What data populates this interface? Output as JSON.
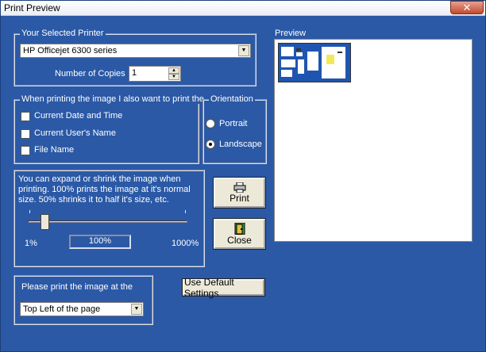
{
  "window": {
    "title": "Print Preview",
    "close_glyph": "✕"
  },
  "printer": {
    "group_label": "Your Selected Printer",
    "selected": "HP Officejet 6300 series",
    "copies_label": "Number of Copies",
    "copies_value": "1"
  },
  "options": {
    "group_label": "When printing the image I also want to print the",
    "items": [
      {
        "label": "Current Date and Time",
        "checked": false
      },
      {
        "label": "Current User's Name",
        "checked": false
      },
      {
        "label": "File Name",
        "checked": false
      }
    ]
  },
  "orientation": {
    "group_label": "Orientation",
    "portrait": "Portrait",
    "landscape": "Landscape",
    "selected": "Landscape"
  },
  "scale": {
    "description": "You can expand or shrink the image when printing.  100% prints the image at it's normal size.  50% shrinks it to half it's size, etc.",
    "min_label": "1%",
    "max_label": "1000%",
    "value_label": "100%",
    "value": 100
  },
  "buttons": {
    "print": "Print",
    "close": "Close",
    "defaults": "Use Default Settings"
  },
  "position": {
    "label": "Please print the image at the",
    "selected": "Top Left of the page"
  },
  "preview": {
    "label": "Preview"
  },
  "icons": {
    "print": "printer-icon",
    "close": "door-icon",
    "dropdown": "chevron-down-icon"
  }
}
